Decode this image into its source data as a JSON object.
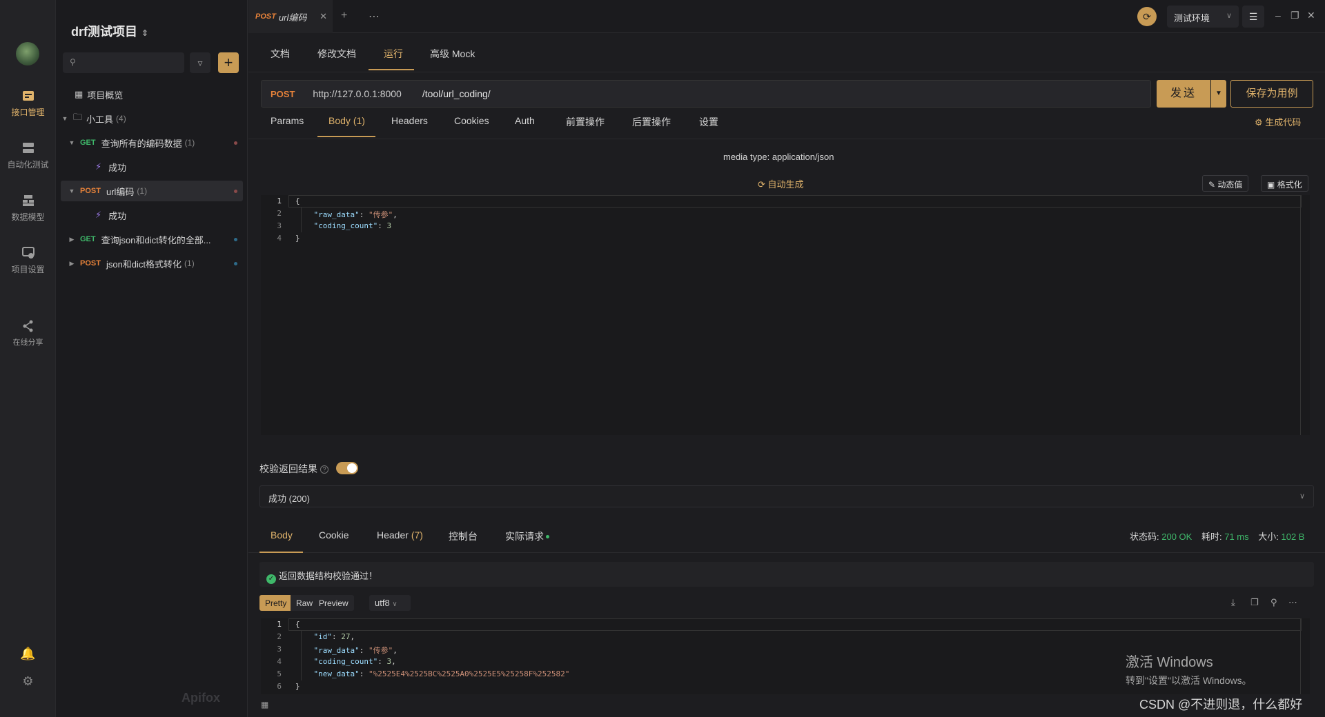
{
  "rail": {
    "items": [
      {
        "label": "接口管理",
        "active": true
      },
      {
        "label": "自动化测试"
      },
      {
        "label": "数据模型"
      },
      {
        "label": "项目设置"
      },
      {
        "label": "在线分享"
      }
    ]
  },
  "sidebar": {
    "project_title": "drf测试项目",
    "overview": "项目概览",
    "folder": {
      "label": "小工具",
      "count": "(4)"
    },
    "items": [
      {
        "method": "GET",
        "label": "查询所有的编码数据",
        "count": "(1)",
        "case": "成功"
      },
      {
        "method": "POST",
        "label": "url编码",
        "count": "(1)",
        "case": "成功"
      },
      {
        "method": "GET",
        "label": "查询json和dict转化的全部...",
        "count": ""
      },
      {
        "method": "POST",
        "label": "json和dict格式转化",
        "count": "(1)"
      }
    ],
    "watermark": "Apifox"
  },
  "topbar": {
    "tab_method": "POST",
    "tab_label": "url编码",
    "env": "测试环境"
  },
  "subtabs": [
    "文档",
    "修改文档",
    "运行",
    "高级 Mock"
  ],
  "request": {
    "method": "POST",
    "base_url": "http://127.0.0.1:8000",
    "path": "/tool/url_coding/",
    "send": "发送",
    "save_as": "保存为用例"
  },
  "req_tabs": [
    {
      "label": "Params"
    },
    {
      "label": "Body",
      "count": "(1)"
    },
    {
      "label": "Headers"
    },
    {
      "label": "Cookies"
    },
    {
      "label": "Auth"
    },
    {
      "label": "前置操作"
    },
    {
      "label": "后置操作"
    },
    {
      "label": "设置"
    }
  ],
  "gen_code": "生成代码",
  "body": {
    "media_type": "media type: application/json",
    "auto_gen": "自动生成",
    "dynamic": "动态值",
    "format": "格式化",
    "lines": [
      "1",
      "2",
      "3",
      "4"
    ]
  },
  "validate": {
    "label": "校验返回结果",
    "enabled": true
  },
  "status_select": "成功 (200)",
  "resp_tabs": [
    {
      "label": "Body"
    },
    {
      "label": "Cookie"
    },
    {
      "label": "Header",
      "count": "(7)"
    },
    {
      "label": "控制台"
    },
    {
      "label": "实际请求"
    }
  ],
  "metrics": {
    "status_label": "状态码:",
    "status": "200 OK",
    "time_label": "耗时:",
    "time": "71 ms",
    "size_label": "大小:",
    "size": "102 B"
  },
  "pass_msg": "返回数据结构校验通过！",
  "resp_formats": [
    "Pretty",
    "Raw",
    "Preview"
  ],
  "encoding": "utf8",
  "response": {
    "lines": [
      "1",
      "2",
      "3",
      "4",
      "5",
      "6"
    ]
  },
  "overlay": {
    "activate_title": "激活 Windows",
    "activate_sub": "转到\"设置\"以激活 Windows。",
    "csdn": "CSDN @不进则退，什么都好"
  },
  "colors": {
    "accent": "#c89b55",
    "get": "#3fb86a",
    "post": "#e8833a"
  }
}
